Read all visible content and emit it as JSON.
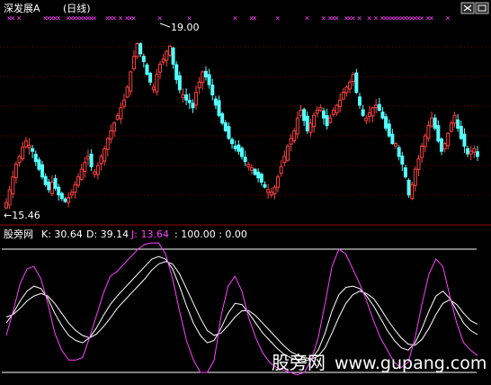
{
  "header": {
    "title": "深发展A",
    "period": "(日线)"
  },
  "price_panel": {
    "high_label": "19.00",
    "low_label": "←15.46",
    "signal_mark": "×"
  },
  "indicator": {
    "name": "股旁网",
    "k_label": "K: 30.64",
    "d_label": "D: 39.14",
    "j_label": "J: 13.64",
    "levels_label": ": 100.00 : 0.00"
  },
  "watermark": {
    "brand": "股旁网",
    "url": "www.gupang.com"
  },
  "colors": {
    "up": "#ff4040",
    "down": "#54ffff",
    "k_line": "#ffffff",
    "d_line": "#ffffff",
    "j_line": "#ff40ff",
    "level_line": "#ffffff",
    "grid": "#7a0000"
  },
  "chart_data": [
    {
      "type": "candlestick",
      "title": "深发展A (日线)",
      "ylim": [
        15.3,
        19.3
      ],
      "annotations": [
        "19.00",
        "←15.46"
      ],
      "close": [
        15.7,
        15.95,
        16.2,
        16.45,
        16.6,
        16.78,
        16.9,
        16.82,
        16.7,
        16.5,
        16.35,
        16.2,
        16.05,
        15.95,
        16.1,
        15.98,
        15.85,
        15.78,
        15.72,
        15.8,
        15.9,
        16.05,
        16.2,
        16.35,
        16.48,
        16.6,
        16.4,
        16.3,
        16.42,
        16.6,
        16.75,
        16.95,
        17.1,
        17.25,
        17.4,
        17.55,
        17.7,
        17.95,
        18.25,
        18.55,
        18.8,
        18.6,
        18.45,
        18.2,
        18.05,
        17.95,
        18.2,
        18.4,
        18.5,
        18.65,
        18.75,
        18.4,
        18.1,
        17.9,
        17.8,
        17.7,
        17.65,
        17.55,
        17.85,
        18.05,
        18.25,
        18.15,
        18.0,
        17.8,
        17.6,
        17.4,
        17.25,
        17.1,
        16.95,
        16.85,
        16.75,
        16.7,
        16.6,
        16.5,
        16.45,
        16.38,
        16.25,
        16.18,
        16.1,
        16.0,
        15.95,
        15.9,
        16.0,
        16.2,
        16.4,
        16.6,
        16.8,
        16.95,
        17.1,
        17.35,
        17.5,
        17.3,
        17.1,
        17.25,
        17.4,
        17.5,
        17.55,
        17.35,
        17.2,
        17.35,
        17.5,
        17.6,
        17.7,
        17.85,
        17.95,
        18.05,
        18.2,
        17.85,
        17.6,
        17.4,
        17.35,
        17.45,
        17.55,
        17.6,
        17.5,
        17.35,
        17.15,
        17.0,
        16.85,
        16.85,
        16.6,
        16.45,
        16.2,
        15.85,
        16.05,
        16.35,
        16.55,
        16.8,
        17.0,
        17.2,
        17.35,
        17.15,
        16.9,
        16.7,
        16.85,
        17.05,
        17.25,
        17.4,
        17.15,
        16.95,
        16.8,
        16.65,
        16.7,
        16.75,
        16.6
      ]
    },
    {
      "type": "line",
      "title": "股旁网",
      "ylim": [
        -5,
        105
      ],
      "reference_levels": [
        100,
        0
      ],
      "series": [
        {
          "name": "K",
          "values": [
            40,
            48,
            58,
            66,
            70,
            68,
            60,
            48,
            38,
            30,
            26,
            24,
            28,
            36,
            46,
            55,
            62,
            68,
            74,
            80,
            86,
            92,
            94,
            92,
            84,
            70,
            54,
            40,
            30,
            24,
            26,
            36,
            48,
            56,
            55,
            48,
            40,
            32,
            26,
            20,
            15,
            12,
            10,
            9,
            11,
            18,
            32,
            50,
            63,
            69,
            70,
            68,
            62,
            54,
            44,
            34,
            26,
            20,
            18,
            24,
            36,
            50,
            62,
            66,
            60,
            50,
            40,
            34,
            30.64
          ]
        },
        {
          "name": "D",
          "values": [
            45,
            47,
            52,
            58,
            62,
            64,
            62,
            56,
            48,
            40,
            34,
            30,
            28,
            31,
            37,
            44,
            52,
            58,
            64,
            70,
            76,
            83,
            88,
            90,
            88,
            80,
            68,
            56,
            44,
            34,
            30,
            32,
            38,
            45,
            50,
            50,
            46,
            40,
            34,
            28,
            22,
            17,
            14,
            12,
            11,
            13,
            20,
            32,
            45,
            56,
            63,
            66,
            64,
            60,
            52,
            43,
            35,
            28,
            23,
            22,
            27,
            36,
            47,
            56,
            59,
            55,
            48,
            42,
            39.14
          ]
        },
        {
          "name": "J",
          "values": [
            30,
            50,
            72,
            84,
            86,
            76,
            56,
            32,
            18,
            10,
            10,
            12,
            28,
            46,
            64,
            78,
            82,
            88,
            94,
            100,
            104,
            108,
            106,
            96,
            76,
            50,
            26,
            10,
            0,
            0,
            10,
            46,
            70,
            78,
            66,
            44,
            28,
            16,
            8,
            4,
            2,
            0,
            -2,
            0,
            10,
            28,
            56,
            86,
            100,
            96,
            84,
            72,
            58,
            42,
            28,
            18,
            8,
            4,
            8,
            28,
            56,
            80,
            92,
            86,
            62,
            40,
            24,
            18,
            13.64
          ]
        }
      ]
    }
  ]
}
